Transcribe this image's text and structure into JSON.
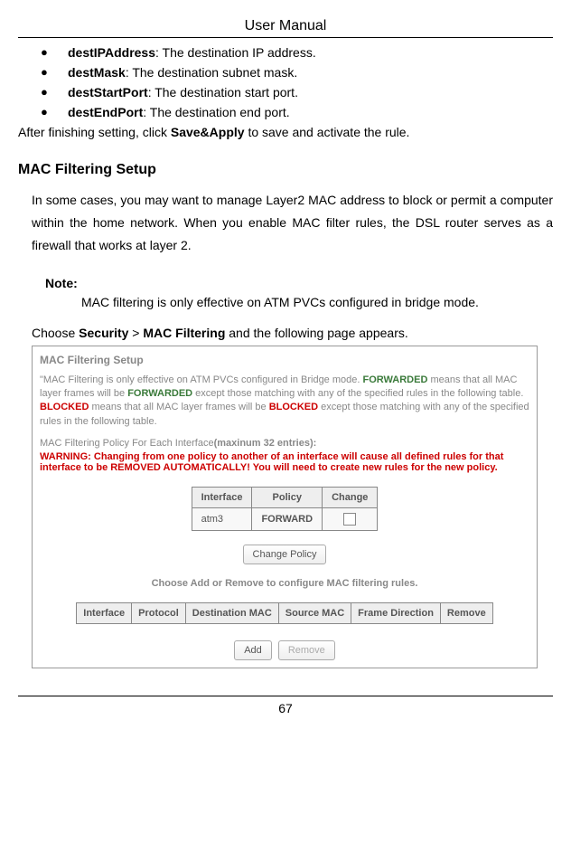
{
  "header": {
    "title": "User Manual"
  },
  "bullets": [
    {
      "term": "destIPAddress",
      "desc": ": The destination IP address."
    },
    {
      "term": "destMask",
      "desc": ": The destination subnet mask."
    },
    {
      "term": "destStartPort",
      "desc": ": The destination start port."
    },
    {
      "term": "destEndPort",
      "desc": ": The destination end port."
    }
  ],
  "afterSetting": {
    "prefix": "After finishing setting, click ",
    "bold": "Save&Apply",
    "suffix": " to save and activate the rule."
  },
  "sectionHeading": "MAC Filtering Setup",
  "introPara": "In some cases, you may want to manage Layer2 MAC address to block or permit a computer within the home network. When you enable MAC filter rules, the DSL router serves as a firewall that works at layer 2.",
  "note": {
    "label": "Note:",
    "text": "MAC filtering is only effective on ATM PVCs configured in bridge mode."
  },
  "chooseLine": {
    "prefix": "Choose ",
    "b1": "Security",
    "mid": " > ",
    "b2": "MAC Filtering",
    "suffix": " and the following page appears."
  },
  "screenshot": {
    "title": "MAC Filtering Setup",
    "explanation": {
      "p1a": "\"MAC Filtering is only effective on ATM PVCs configured in Bridge mode. ",
      "forwarded": "FORWARDED",
      "p1b": " means that all MAC layer frames will be ",
      "forwarded2": "FORWARDED",
      "p1c": " except those matching with any of the specified rules in the following table. ",
      "blocked": "BLOCKED",
      "p1d": " means that all MAC layer frames will be ",
      "blocked2": "BLOCKED",
      "p1e": " except those matching with any of the specified rules in the following table."
    },
    "policyLine": {
      "a": "MAC Filtering Policy For Each Interface",
      "b": "(maxinum 32 entries):"
    },
    "warning": "WARNING: Changing from one policy to another of an interface will cause all defined rules for that interface to be REMOVED AUTOMATICALLY! You will need to create new rules for the new policy.",
    "policyTable": {
      "headers": [
        "Interface",
        "Policy",
        "Change"
      ],
      "row": {
        "interface": "atm3",
        "policy": "FORWARD"
      }
    },
    "changePolicyBtn": "Change Policy",
    "chooseText": "Choose Add or Remove to configure MAC filtering rules.",
    "rulesHeaders": [
      "Interface",
      "Protocol",
      "Destination MAC",
      "Source MAC",
      "Frame Direction",
      "Remove"
    ],
    "addBtn": "Add",
    "removeBtn": "Remove"
  },
  "pageNumber": "67"
}
